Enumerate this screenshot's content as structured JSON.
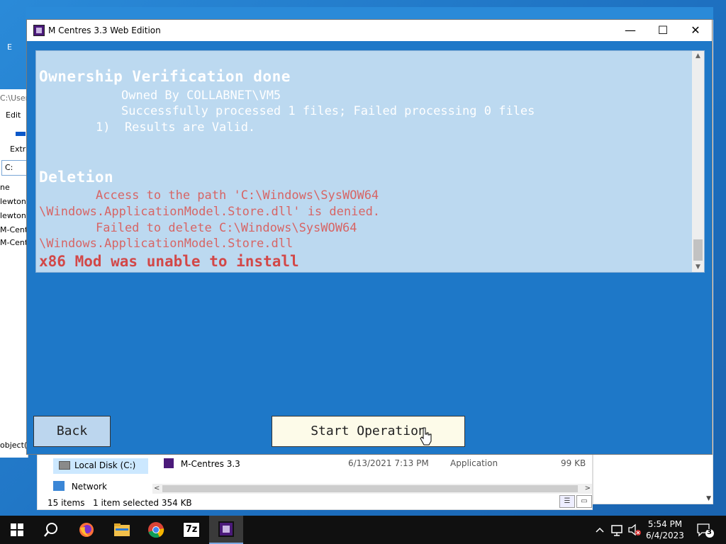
{
  "dialog": {
    "title": "M Centres 3.3 Web Edition",
    "minimize_glyph": "—",
    "maximize_glyph": "☐",
    "close_glyph": "✕"
  },
  "log": {
    "ownership_heading": "Ownership Verification done",
    "owned_by": "Owned By COLLABNET\\VM5",
    "processed": "Successfully processed 1 files; Failed processing 0 files",
    "results": "1)  Results are Valid.",
    "deletion_heading": "Deletion",
    "access_line1": "Access to the path 'C:\\Windows\\SysWOW64",
    "access_line2": "\\Windows.ApplicationModel.Store.dll' is denied.",
    "failed_line1": "Failed to delete C:\\Windows\\SysWOW64",
    "failed_line2": "\\Windows.ApplicationModel.Store.dll",
    "error": "x86 Mod was unable to install"
  },
  "buttons": {
    "back": "Back",
    "start": "Start Operation"
  },
  "background_explorer": {
    "address": "C:\\User",
    "edit": "Edit",
    "extract": "Extr",
    "path_box": "C:",
    "rows": [
      "ne",
      "lewtons",
      "lewtons",
      "M-Centr",
      "M-Centr"
    ],
    "objects": "object(s",
    "top_left_letter": "E"
  },
  "explorer_bottom": {
    "nav_local_disk": "Local Disk (C:)",
    "nav_network": "Network",
    "file_name": "M-Centres 3.3",
    "file_date": "6/13/2021 7:13 PM",
    "file_type": "Application",
    "file_size": "99 KB",
    "status_items": "15 items",
    "status_selected": "1 item selected  354 KB"
  },
  "taskbar": {
    "time": "5:54 PM",
    "date": "6/4/2023",
    "notification_count": "3",
    "zip_label": "7z"
  },
  "colors": {
    "dialog_bg": "#1e78c8",
    "log_bg": "#bcd9f0",
    "error_red": "#d24848",
    "start_button_bg": "#fdfbe9",
    "back_button_bg": "#bcd6ee"
  }
}
